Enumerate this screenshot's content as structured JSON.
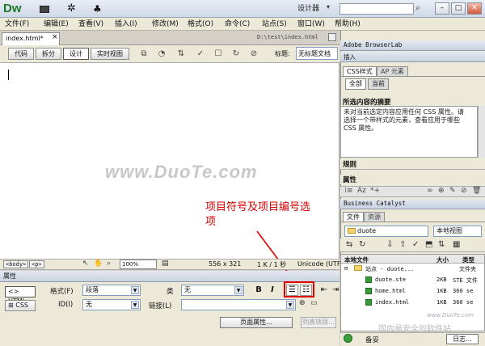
{
  "app": {
    "logo": "Dw",
    "workspace": "设计器",
    "window_buttons": [
      "–",
      "□",
      "✕"
    ]
  },
  "menu": [
    "文件(F)",
    "编辑(E)",
    "查看(V)",
    "插入(I)",
    "修改(M)",
    "格式(O)",
    "命令(C)",
    "站点(S)",
    "窗口(W)",
    "帮助(H)"
  ],
  "doc": {
    "tab": "index.html*",
    "close": "×",
    "path": "D:\\test\\index.html"
  },
  "views": {
    "code": "代码",
    "split": "拆分",
    "design": "设计",
    "live": "实时视图",
    "title_label": "标题:",
    "title_value": "无标题文档"
  },
  "watermark": "www.DuoTe.com",
  "annotation": "项目符号及项目编号选项",
  "status": {
    "body_tag": "<body>",
    "p_tag": "<p>",
    "zoom": "100%",
    "size": "556 x 321",
    "filesize": "1 K / 1 秒",
    "encoding": "Unicode (UTF"
  },
  "properties": {
    "header": "属性",
    "html_btn": "HTML",
    "css_btn": "CSS",
    "format_label": "格式(F)",
    "format_value": "段落",
    "class_label": "类",
    "class_value": "无",
    "id_label": "ID(I)",
    "id_value": "无",
    "link_label": "链接(L)",
    "link_value": "",
    "bold": "B",
    "italic": "I",
    "ul_icon": "☰",
    "ol_icon": "☷",
    "page_props": "页面属性...",
    "list_item": "列表项目..."
  },
  "right": {
    "browserlab": "Adobe BrowserLab",
    "insert": "插入",
    "css_tab": "CSS样式",
    "ap_tab": "AP 元素",
    "all_btn": "全部",
    "current_btn": "当前",
    "summary_title": "所选内容的摘要",
    "summary_text": "未对当前选定内容应用任何 CSS 属性。请选择一个带样式的元素，查看应用于哪些 CSS 属性。",
    "rules": "规则",
    "attributes": "属性",
    "business": "Business Catalyst",
    "files_tab": "文件",
    "assets_tab": "资源",
    "site_select": "duote",
    "view_select": "本地视图",
    "col_local": "本地文件",
    "col_size": "大小",
    "col_type": "类型",
    "files": [
      {
        "name": "站点 - duote...",
        "size": "",
        "type": "文件夹"
      },
      {
        "name": "duote.ste",
        "size": "2KB",
        "type": "STE 文件"
      },
      {
        "name": "home.html",
        "size": "1KB",
        "type": "360 se"
      },
      {
        "name": "index.html",
        "size": "1KB",
        "type": "360 se"
      }
    ],
    "backup": "备妥",
    "log": "日志...",
    "wm1": "www.DuoTe.com",
    "wm2": "国内最安全的软件站"
  }
}
